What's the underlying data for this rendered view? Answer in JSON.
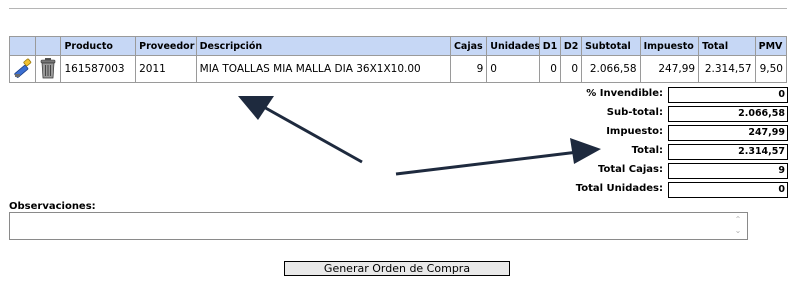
{
  "table": {
    "headers": {
      "producto": "Producto",
      "proveedor": "Proveedor",
      "descripcion": "Descripción",
      "cajas": "Cajas",
      "unidades": "Unidades",
      "d1": "D1",
      "d2": "D2",
      "subtotal": "Subtotal",
      "impuesto": "Impuesto",
      "total": "Total",
      "pmv": "PMV"
    },
    "rows": [
      {
        "producto": "161587003",
        "proveedor": "2011",
        "descripcion": "MIA TOALLAS MIA MALLA DIA 36X1X10.00",
        "cajas": "9",
        "unidades": "0",
        "d1": "0",
        "d2": "0",
        "subtotal": "2.066,58",
        "impuesto": "247,99",
        "total": "2.314,57",
        "pmv": "9,50"
      }
    ],
    "row_icons": [
      "edit-icon",
      "trash-icon"
    ]
  },
  "totals": {
    "invendible_label": "% Invendible:",
    "invendible_value": "0",
    "subtotal_label": "Sub-total:",
    "subtotal_value": "2.066,58",
    "impuesto_label": "Impuesto:",
    "impuesto_value": "247,99",
    "total_label": "Total:",
    "total_value": "2.314,57",
    "cajas_label": "Total Cajas:",
    "cajas_value": "9",
    "unidades_label": "Total Unidades:",
    "unidades_value": "0"
  },
  "observaciones": {
    "label": "Observaciones:",
    "value": ""
  },
  "actions": {
    "generar_label": "Generar Orden de Compra"
  },
  "colors": {
    "header_bg": "#c6d7f5",
    "arrow": "#1e2a3e"
  }
}
